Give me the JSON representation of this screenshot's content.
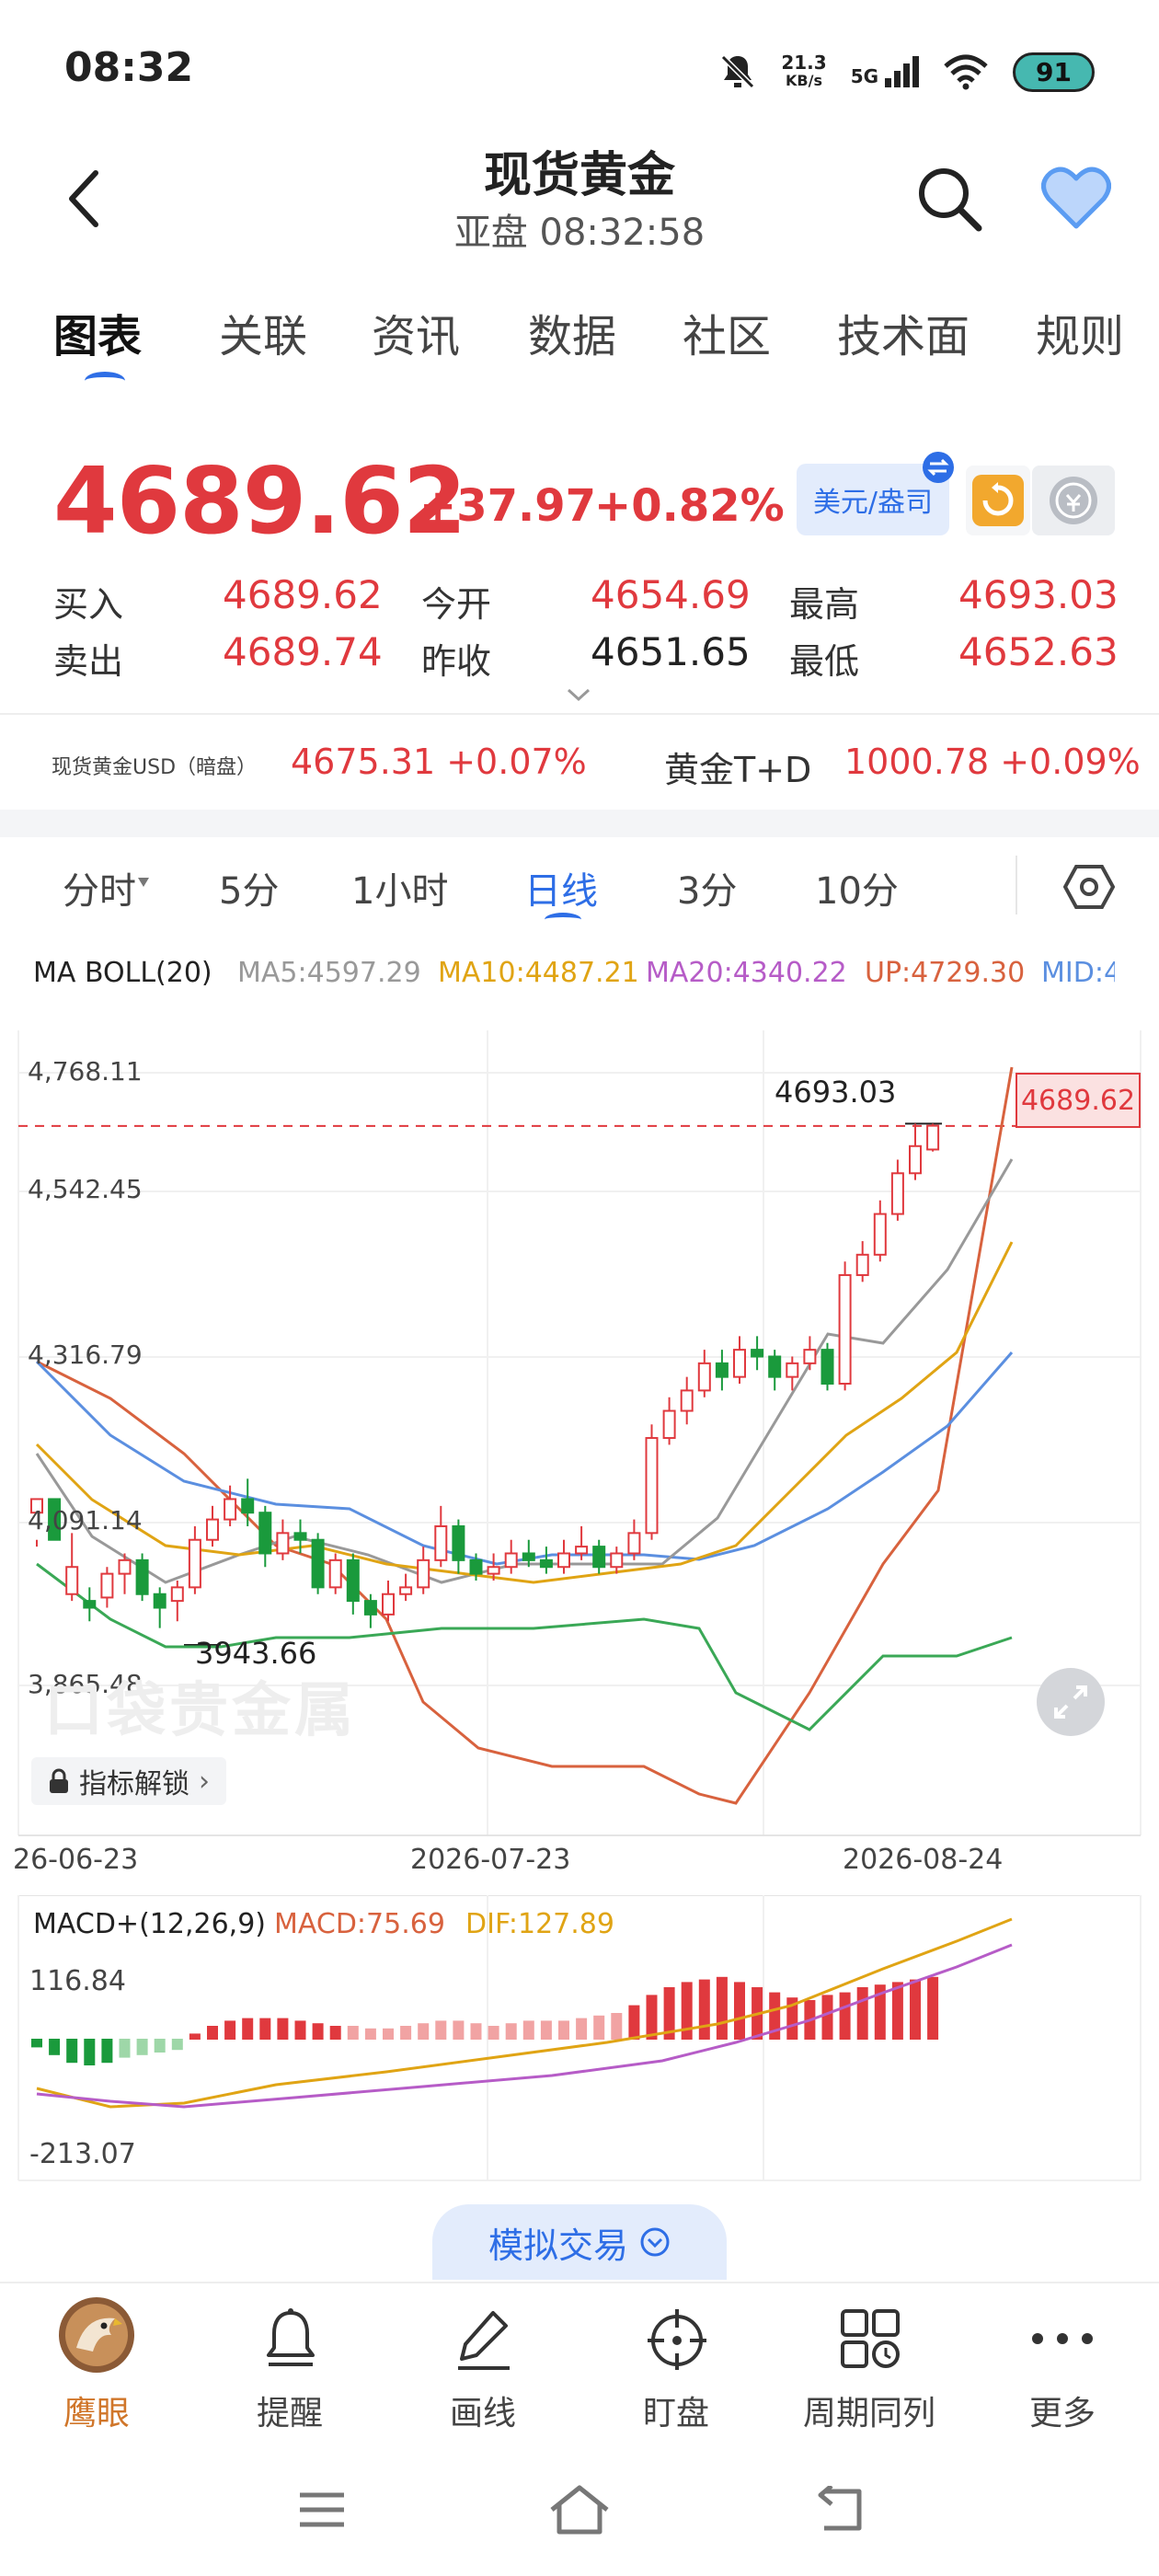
{
  "status": {
    "time": "08:32",
    "net_speed": "21.3",
    "net_unit": "KB/s",
    "signal": "5G",
    "battery": "91"
  },
  "header": {
    "title": "现货黄金",
    "subtitle": "亚盘   08:32:58"
  },
  "tabs": [
    "图表",
    "关联",
    "资讯",
    "数据",
    "社区",
    "技术面",
    "规则"
  ],
  "quote": {
    "price": "4689.62",
    "change": "+37.97",
    "change_pct": "+0.82%",
    "unit_label": "美元/盎司",
    "buy_label": "买入",
    "buy": "4689.62",
    "sell_label": "卖出",
    "sell": "4689.74",
    "open_label": "今开",
    "open": "4654.69",
    "prev_close_label": "昨收",
    "prev_close": "4651.65",
    "high_label": "最高",
    "high": "4693.03",
    "low_label": "最低",
    "low": "4652.63"
  },
  "dark_pool": {
    "label1": "现货黄金USD（暗盘）",
    "value1": "4675.31 +0.07%",
    "label2": "黄金T+D",
    "value2": "1000.78 +0.09%"
  },
  "chart_tabs": [
    "分时",
    "5分",
    "1小时",
    "日线",
    "3分",
    "10分"
  ],
  "indicators": {
    "boll_label": "MA BOLL(20)",
    "ma5": "MA5:4597.29",
    "ma10": "MA10:4487.21",
    "ma20": "MA20:4340.22",
    "up": "UP:4729.30",
    "mid": "MID:4"
  },
  "chart_data": {
    "type": "candlestick",
    "y_ticks": [
      "4,768.11",
      "4,542.45",
      "4,316.79",
      "4,091.14",
      "3,865.48"
    ],
    "ylim": [
      3865.48,
      4768.11
    ],
    "x_ticks": [
      "26-06-23",
      "2026-07-23",
      "2026-08-24"
    ],
    "high_marker": "4693.03",
    "low_marker": "3943.66",
    "last_price": "4689.62",
    "unlock_label": "指标解锁",
    "watermark": "口袋贵金属"
  },
  "macd": {
    "label": "MACD+(12,26,9)",
    "macd": "MACD:75.69",
    "dif": "DIF:127.89",
    "y_top": "116.84",
    "y_bottom": "-213.07"
  },
  "sim_trade": "模拟交易",
  "bottom_nav": [
    "鹰眼",
    "提醒",
    "画线",
    "盯盘",
    "周期同列",
    "更多"
  ],
  "colors": {
    "up": "#e0393e",
    "down": "#1a9a3c",
    "accent": "#2e6ee6"
  }
}
